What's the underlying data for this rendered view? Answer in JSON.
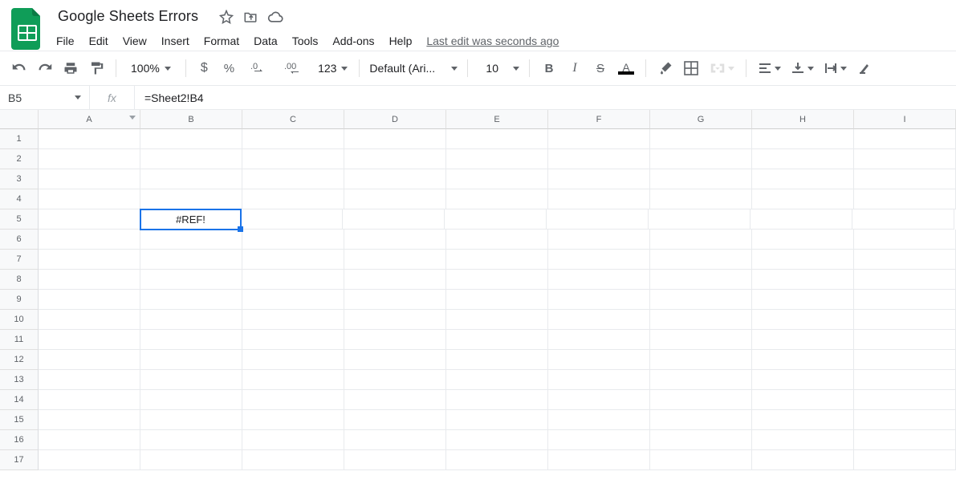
{
  "title": "Google Sheets Errors",
  "menus": [
    "File",
    "Edit",
    "View",
    "Insert",
    "Format",
    "Data",
    "Tools",
    "Add-ons",
    "Help"
  ],
  "last_edit": "Last edit was seconds ago",
  "toolbar": {
    "zoom": "100%",
    "number_format": "123",
    "font": "Default (Ari...",
    "font_size": "10"
  },
  "namebox": "B5",
  "fx_label": "fx",
  "formula": "=Sheet2!B4",
  "columns": [
    "A",
    "B",
    "C",
    "D",
    "E",
    "F",
    "G",
    "H",
    "I"
  ],
  "rows": [
    "1",
    "2",
    "3",
    "4",
    "5",
    "6",
    "7",
    "8",
    "9",
    "10",
    "11",
    "12",
    "13",
    "14",
    "15",
    "16",
    "17"
  ],
  "selected": {
    "row": "5",
    "col": "B",
    "value": "#REF!"
  }
}
